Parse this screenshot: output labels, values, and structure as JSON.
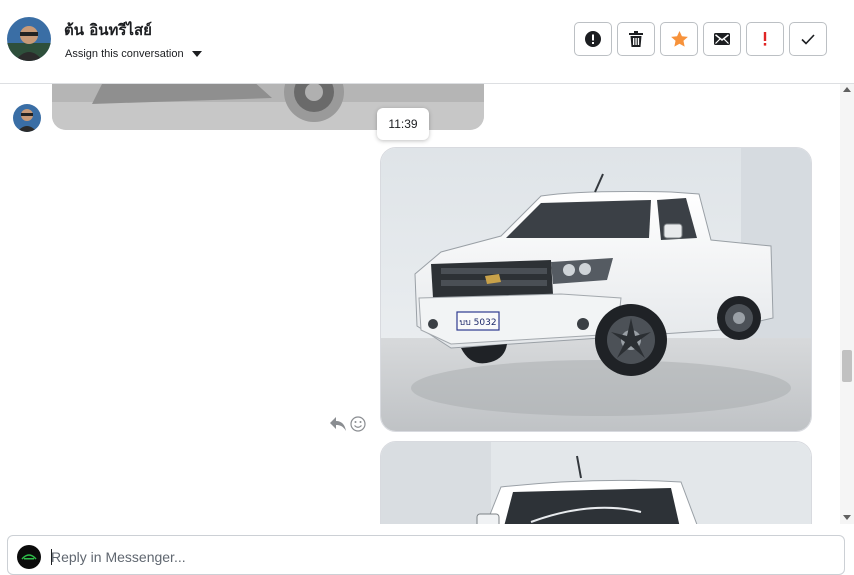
{
  "contact": {
    "name": "ต้น อินทรีไสย์",
    "assign_label": "Assign this conversation"
  },
  "actions": [
    {
      "name": "mark-spam",
      "icon": "exclamation-circle-icon"
    },
    {
      "name": "delete",
      "icon": "trash-icon"
    },
    {
      "name": "star",
      "icon": "star-icon",
      "color": "#f7923b"
    },
    {
      "name": "mark-unread",
      "icon": "envelope-icon"
    },
    {
      "name": "follow-up",
      "icon": "exclamation-icon",
      "color": "#e02424"
    },
    {
      "name": "mark-done",
      "icon": "check-icon"
    }
  ],
  "thread": {
    "timestamp": "11:39",
    "license_plate": "บบ 5032"
  },
  "reply": {
    "placeholder": "Reply in Messenger..."
  }
}
